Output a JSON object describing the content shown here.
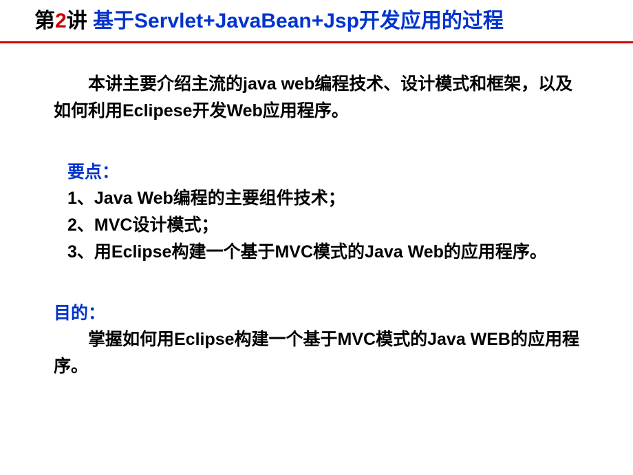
{
  "title": {
    "prefix_char1": "第",
    "number": "2",
    "prefix_char2": "讲 ",
    "main": "基于Servlet+JavaBean+Jsp开发应用的过程"
  },
  "intro": "本讲主要介绍主流的java web编程技术、设计模式和框架，以及如何利用Eclipese开发Web应用程序。",
  "points_label": "要点：",
  "points": [
    "1、Java Web编程的主要组件技术；",
    "2、MVC设计模式；",
    "3、用Eclipse构建一个基于MVC模式的Java Web的应用程序。"
  ],
  "purpose_label": "目的：",
  "purpose_text": "掌握如何用Eclipse构建一个基于MVC模式的Java WEB的应用程序。"
}
